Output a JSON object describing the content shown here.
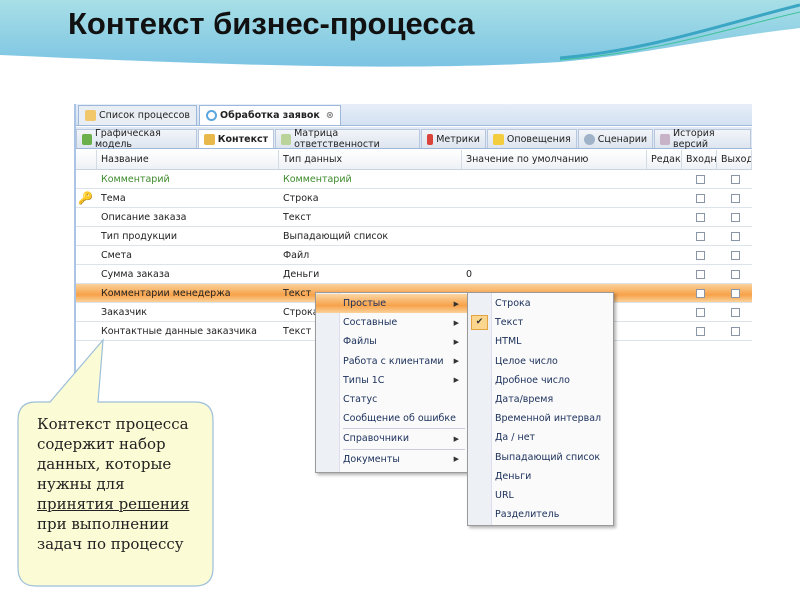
{
  "slide": {
    "title": "Контекст бизнес-процесса"
  },
  "window": {
    "doc_tabs": [
      {
        "label": "Список процессов",
        "active": false
      },
      {
        "label": "Обработка заявок",
        "active": true
      }
    ],
    "view_tabs": [
      {
        "label": "Графическая модель"
      },
      {
        "label": "Контекст",
        "active": true
      },
      {
        "label": "Матрица ответственности"
      },
      {
        "label": "Метрики"
      },
      {
        "label": "Оповещения"
      },
      {
        "label": "Сценарии"
      },
      {
        "label": "История версий"
      }
    ],
    "columns": [
      "Название",
      "Тип данных",
      "Значение по умолчанию",
      "Редак",
      "Входн",
      "Выход"
    ],
    "rows": [
      {
        "name": "Комментарий",
        "type": "Комментарий",
        "default": "",
        "style": "green"
      },
      {
        "name": "Тема",
        "type": "Строка",
        "default": "",
        "icon": "key"
      },
      {
        "name": "Описание заказа",
        "type": "Текст",
        "default": ""
      },
      {
        "name": "Тип продукции",
        "type": "Выпадающий список",
        "default": ""
      },
      {
        "name": "Смета",
        "type": "Файл",
        "default": ""
      },
      {
        "name": "Сумма заказа",
        "type": "Деньги",
        "default": "0"
      },
      {
        "name": "Комментарии менедержа",
        "type": "Текст",
        "default": "",
        "selected": true
      },
      {
        "name": "Заказчик",
        "type": "Строка",
        "default": ""
      },
      {
        "name": "Контактные данные заказчика",
        "type": "Текст",
        "default": ""
      }
    ]
  },
  "context_menu": {
    "items": [
      "Простые",
      "Составные",
      "Файлы",
      "Работа с клиентами",
      "Типы 1С",
      "Статус",
      "Сообщение об ошибке",
      "Справочники",
      "Документы"
    ]
  },
  "submenu": {
    "items": [
      "Строка",
      "Текст",
      "HTML",
      "Целое число",
      "Дробное число",
      "Дата/время",
      "Временной интервал",
      "Да / нет",
      "Выпадающий список",
      "Деньги",
      "URL",
      "Разделитель"
    ],
    "checked": "Текст"
  },
  "callout": {
    "lines": [
      "Контекст процесса",
      "содержит набор",
      "данных, которые",
      "нужны для",
      "принятия решения",
      "при выполнении",
      "задач по процессу"
    ]
  }
}
